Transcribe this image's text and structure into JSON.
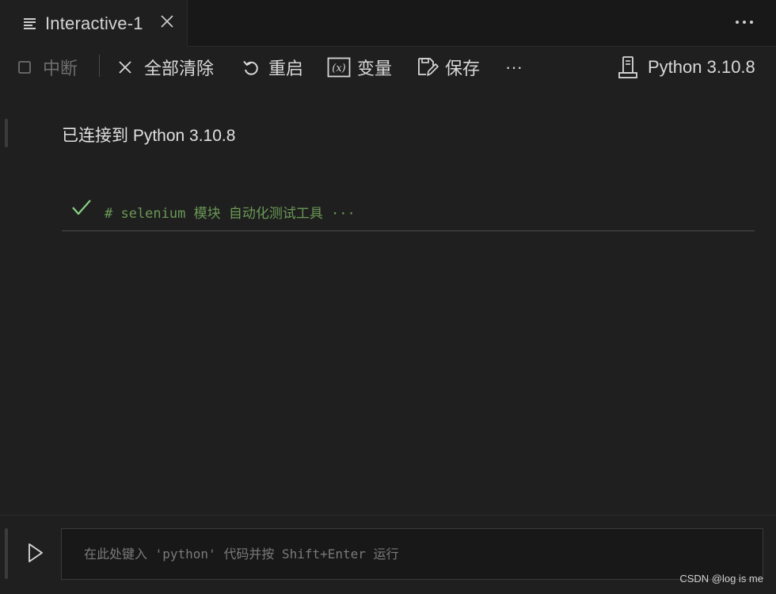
{
  "tab": {
    "title": "Interactive-1",
    "icon": "notebook-lines-icon"
  },
  "toolbar": {
    "interrupt_label": "中断",
    "clear_all_label": "全部清除",
    "restart_label": "重启",
    "variables_label": "变量",
    "save_label": "保存",
    "more_label": "···",
    "kernel_label": "Python 3.10.8"
  },
  "content": {
    "connected_text": "已连接到 Python 3.10.8",
    "cell_code": "# selenium 模块 自动化测试工具 ···",
    "cell_status": "success"
  },
  "input": {
    "placeholder": "在此处键入 'python' 代码并按 Shift+Enter 运行"
  },
  "watermark": "CSDN @log is me",
  "colors": {
    "background": "#1f1f1f",
    "comment_green": "#6a9955",
    "check_green": "#89d185"
  }
}
